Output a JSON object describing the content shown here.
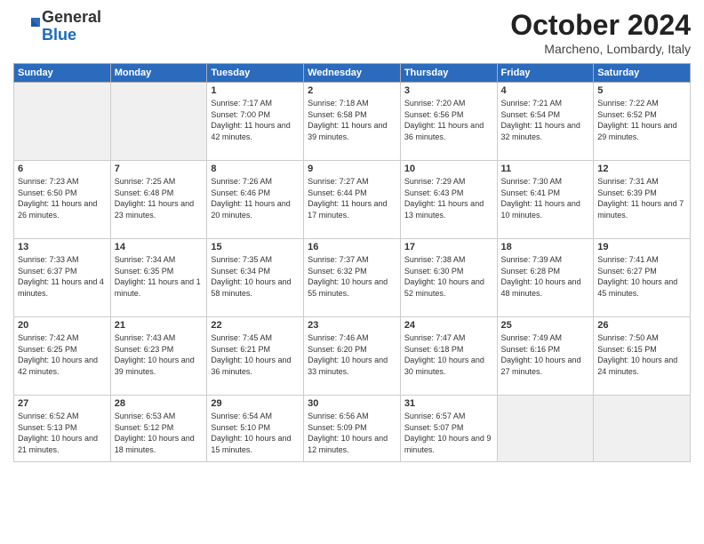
{
  "header": {
    "logo": {
      "line1": "General",
      "line2": "Blue"
    },
    "title": "October 2024",
    "location": "Marcheno, Lombardy, Italy"
  },
  "days_of_week": [
    "Sunday",
    "Monday",
    "Tuesday",
    "Wednesday",
    "Thursday",
    "Friday",
    "Saturday"
  ],
  "weeks": [
    [
      {
        "day": "",
        "info": ""
      },
      {
        "day": "",
        "info": ""
      },
      {
        "day": "1",
        "info": "Sunrise: 7:17 AM\nSunset: 7:00 PM\nDaylight: 11 hours and 42 minutes."
      },
      {
        "day": "2",
        "info": "Sunrise: 7:18 AM\nSunset: 6:58 PM\nDaylight: 11 hours and 39 minutes."
      },
      {
        "day": "3",
        "info": "Sunrise: 7:20 AM\nSunset: 6:56 PM\nDaylight: 11 hours and 36 minutes."
      },
      {
        "day": "4",
        "info": "Sunrise: 7:21 AM\nSunset: 6:54 PM\nDaylight: 11 hours and 32 minutes."
      },
      {
        "day": "5",
        "info": "Sunrise: 7:22 AM\nSunset: 6:52 PM\nDaylight: 11 hours and 29 minutes."
      }
    ],
    [
      {
        "day": "6",
        "info": "Sunrise: 7:23 AM\nSunset: 6:50 PM\nDaylight: 11 hours and 26 minutes."
      },
      {
        "day": "7",
        "info": "Sunrise: 7:25 AM\nSunset: 6:48 PM\nDaylight: 11 hours and 23 minutes."
      },
      {
        "day": "8",
        "info": "Sunrise: 7:26 AM\nSunset: 6:46 PM\nDaylight: 11 hours and 20 minutes."
      },
      {
        "day": "9",
        "info": "Sunrise: 7:27 AM\nSunset: 6:44 PM\nDaylight: 11 hours and 17 minutes."
      },
      {
        "day": "10",
        "info": "Sunrise: 7:29 AM\nSunset: 6:43 PM\nDaylight: 11 hours and 13 minutes."
      },
      {
        "day": "11",
        "info": "Sunrise: 7:30 AM\nSunset: 6:41 PM\nDaylight: 11 hours and 10 minutes."
      },
      {
        "day": "12",
        "info": "Sunrise: 7:31 AM\nSunset: 6:39 PM\nDaylight: 11 hours and 7 minutes."
      }
    ],
    [
      {
        "day": "13",
        "info": "Sunrise: 7:33 AM\nSunset: 6:37 PM\nDaylight: 11 hours and 4 minutes."
      },
      {
        "day": "14",
        "info": "Sunrise: 7:34 AM\nSunset: 6:35 PM\nDaylight: 11 hours and 1 minute."
      },
      {
        "day": "15",
        "info": "Sunrise: 7:35 AM\nSunset: 6:34 PM\nDaylight: 10 hours and 58 minutes."
      },
      {
        "day": "16",
        "info": "Sunrise: 7:37 AM\nSunset: 6:32 PM\nDaylight: 10 hours and 55 minutes."
      },
      {
        "day": "17",
        "info": "Sunrise: 7:38 AM\nSunset: 6:30 PM\nDaylight: 10 hours and 52 minutes."
      },
      {
        "day": "18",
        "info": "Sunrise: 7:39 AM\nSunset: 6:28 PM\nDaylight: 10 hours and 48 minutes."
      },
      {
        "day": "19",
        "info": "Sunrise: 7:41 AM\nSunset: 6:27 PM\nDaylight: 10 hours and 45 minutes."
      }
    ],
    [
      {
        "day": "20",
        "info": "Sunrise: 7:42 AM\nSunset: 6:25 PM\nDaylight: 10 hours and 42 minutes."
      },
      {
        "day": "21",
        "info": "Sunrise: 7:43 AM\nSunset: 6:23 PM\nDaylight: 10 hours and 39 minutes."
      },
      {
        "day": "22",
        "info": "Sunrise: 7:45 AM\nSunset: 6:21 PM\nDaylight: 10 hours and 36 minutes."
      },
      {
        "day": "23",
        "info": "Sunrise: 7:46 AM\nSunset: 6:20 PM\nDaylight: 10 hours and 33 minutes."
      },
      {
        "day": "24",
        "info": "Sunrise: 7:47 AM\nSunset: 6:18 PM\nDaylight: 10 hours and 30 minutes."
      },
      {
        "day": "25",
        "info": "Sunrise: 7:49 AM\nSunset: 6:16 PM\nDaylight: 10 hours and 27 minutes."
      },
      {
        "day": "26",
        "info": "Sunrise: 7:50 AM\nSunset: 6:15 PM\nDaylight: 10 hours and 24 minutes."
      }
    ],
    [
      {
        "day": "27",
        "info": "Sunrise: 6:52 AM\nSunset: 5:13 PM\nDaylight: 10 hours and 21 minutes."
      },
      {
        "day": "28",
        "info": "Sunrise: 6:53 AM\nSunset: 5:12 PM\nDaylight: 10 hours and 18 minutes."
      },
      {
        "day": "29",
        "info": "Sunrise: 6:54 AM\nSunset: 5:10 PM\nDaylight: 10 hours and 15 minutes."
      },
      {
        "day": "30",
        "info": "Sunrise: 6:56 AM\nSunset: 5:09 PM\nDaylight: 10 hours and 12 minutes."
      },
      {
        "day": "31",
        "info": "Sunrise: 6:57 AM\nSunset: 5:07 PM\nDaylight: 10 hours and 9 minutes."
      },
      {
        "day": "",
        "info": ""
      },
      {
        "day": "",
        "info": ""
      }
    ]
  ]
}
